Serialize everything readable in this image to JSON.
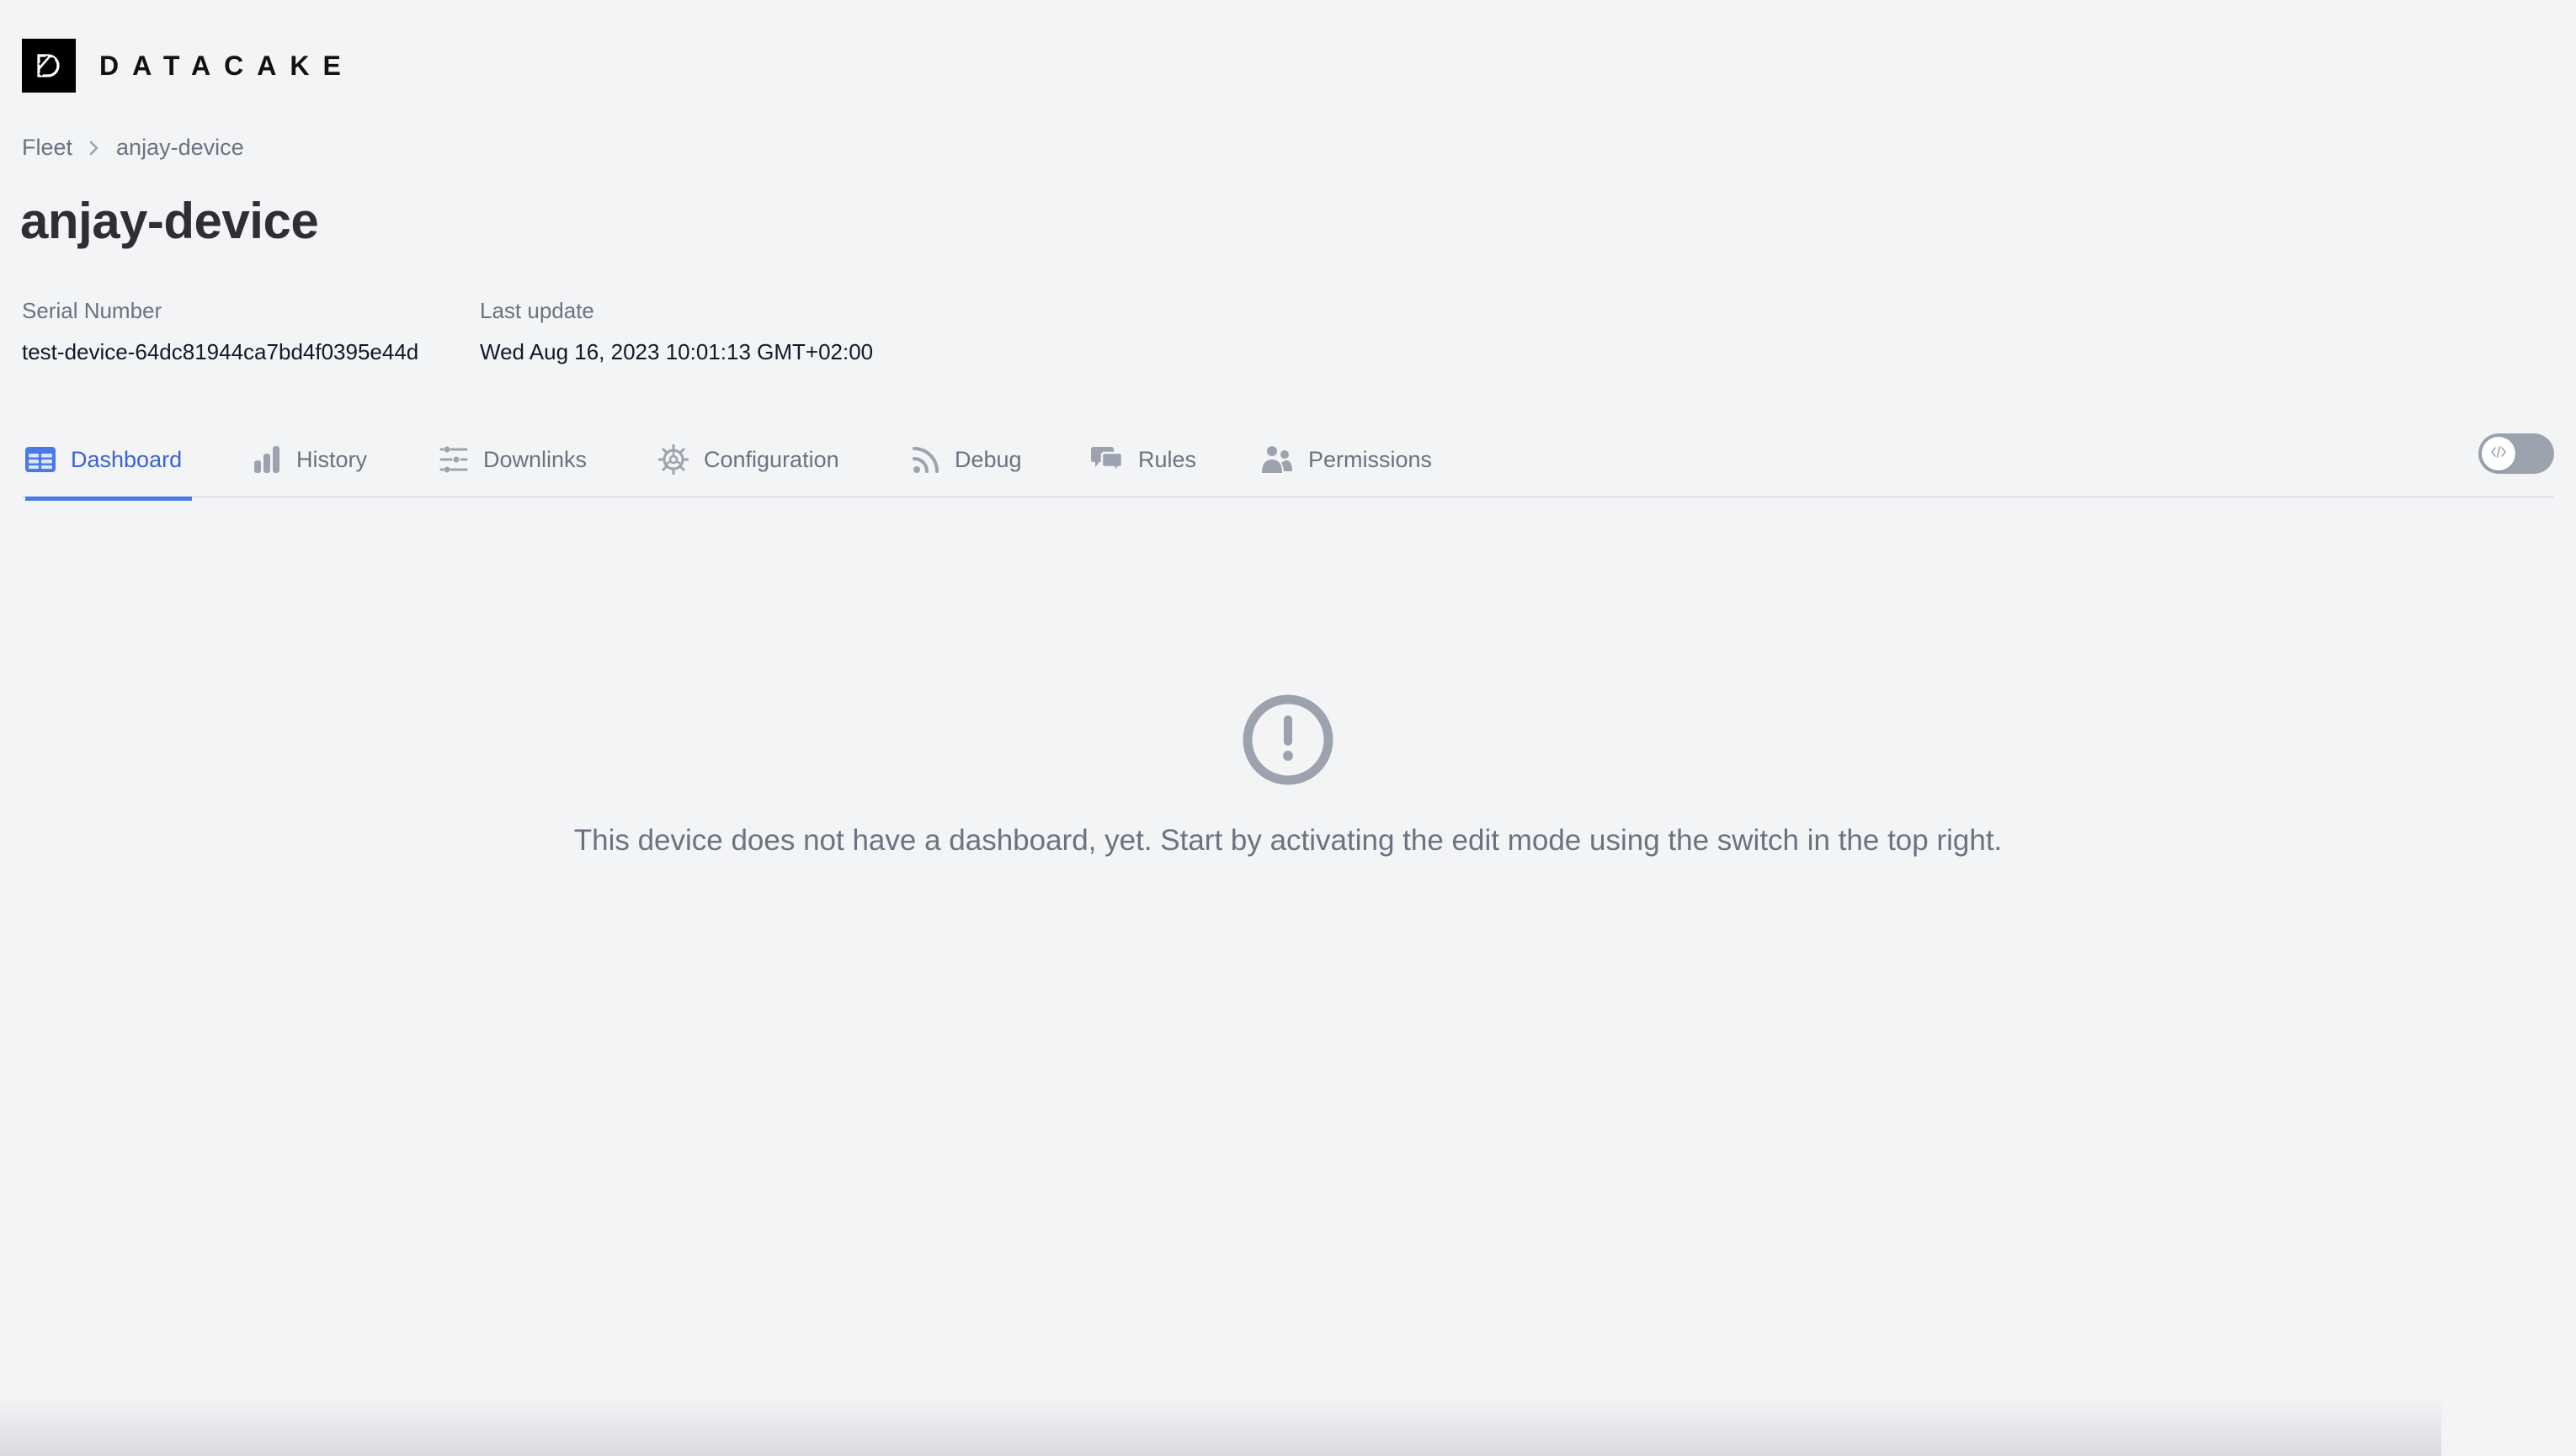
{
  "brand": {
    "name": "DATACAKE",
    "logo_icon": "datacake-logo-icon"
  },
  "breadcrumb": [
    {
      "label": "Fleet"
    },
    {
      "label": "anjay-device"
    }
  ],
  "page_title": "anjay-device",
  "meta": {
    "serial_label": "Serial Number",
    "serial_value": "test-device-64dc81944ca7bd4f0395e44d",
    "updated_label": "Last update",
    "updated_value": "Wed Aug 16, 2023 10:01:13 GMT+02:00"
  },
  "tabs": [
    {
      "label": "Dashboard",
      "icon": "table-icon",
      "active": true
    },
    {
      "label": "History",
      "icon": "bar-chart-icon",
      "active": false
    },
    {
      "label": "Downlinks",
      "icon": "sliders-icon",
      "active": false
    },
    {
      "label": "Configuration",
      "icon": "gear-icon",
      "active": false
    },
    {
      "label": "Debug",
      "icon": "rss-icon",
      "active": false
    },
    {
      "label": "Rules",
      "icon": "chat-bubbles-icon",
      "active": false
    },
    {
      "label": "Permissions",
      "icon": "users-icon",
      "active": false
    }
  ],
  "edit_mode_toggle": {
    "on": false,
    "icon": "code-icon"
  },
  "empty_state": {
    "icon": "exclamation-circle-icon",
    "message": "This device does not have a dashboard, yet. Start by activating the edit mode using the switch in the top right."
  },
  "colors": {
    "accent": "#3b62d6",
    "background": "#f3f4f6",
    "muted_text": "#6b7280",
    "toggle_off": "#9ca3af"
  }
}
